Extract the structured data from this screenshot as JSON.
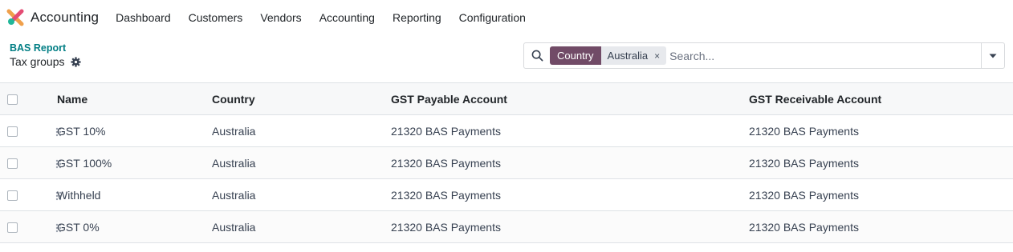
{
  "app": {
    "title": "Accounting",
    "logo_icon": "odoo-accounting-logo"
  },
  "nav": [
    {
      "label": "Dashboard"
    },
    {
      "label": "Customers"
    },
    {
      "label": "Vendors"
    },
    {
      "label": "Accounting"
    },
    {
      "label": "Reporting"
    },
    {
      "label": "Configuration"
    }
  ],
  "breadcrumb": {
    "parent": "BAS Report",
    "current": "Tax groups",
    "settings_icon": "gear-icon"
  },
  "search": {
    "facet_label": "Country",
    "facet_value": "Australia",
    "facet_remove": "×",
    "placeholder": "Search..."
  },
  "table": {
    "columns": [
      "Name",
      "Country",
      "GST Payable Account",
      "GST Receivable Account"
    ],
    "rows": [
      {
        "name": "GST 10%",
        "country": "Australia",
        "payable": "21320 BAS Payments",
        "receivable": "21320 BAS Payments"
      },
      {
        "name": "GST 100%",
        "country": "Australia",
        "payable": "21320 BAS Payments",
        "receivable": "21320 BAS Payments"
      },
      {
        "name": "Withheld",
        "country": "Australia",
        "payable": "21320 BAS Payments",
        "receivable": "21320 BAS Payments"
      },
      {
        "name": "GST 0%",
        "country": "Australia",
        "payable": "21320 BAS Payments",
        "receivable": "21320 BAS Payments"
      }
    ]
  },
  "colors": {
    "brand": "#714b67",
    "link": "#017e84",
    "header_bg": "#f7f8f9"
  }
}
